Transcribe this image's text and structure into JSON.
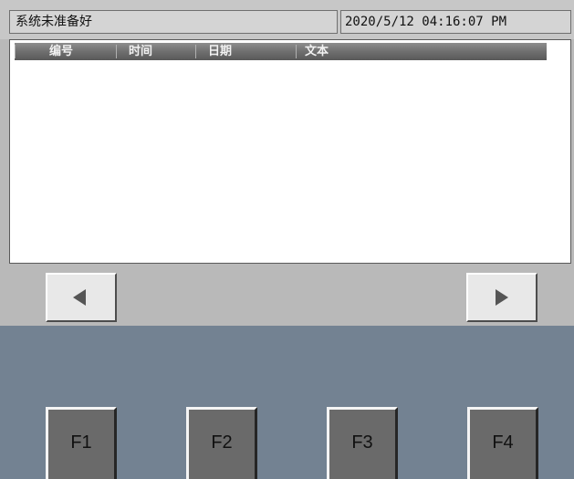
{
  "header": {
    "status_text": "系统未准备好",
    "datetime_text": "2020/5/12 04:16:07 PM"
  },
  "table": {
    "columns": [
      "编号",
      "时间",
      "日期",
      "文本"
    ],
    "rows": []
  },
  "navigation": {
    "prev_icon": "triangle-left-icon",
    "next_icon": "triangle-right-icon"
  },
  "function_keys": [
    "F1",
    "F2",
    "F3",
    "F4"
  ],
  "colors": {
    "panel_background": "#b9b9b9",
    "function_area": "#738292",
    "table_header": "#6f6f6f",
    "key_face": "#6a6a6a"
  }
}
